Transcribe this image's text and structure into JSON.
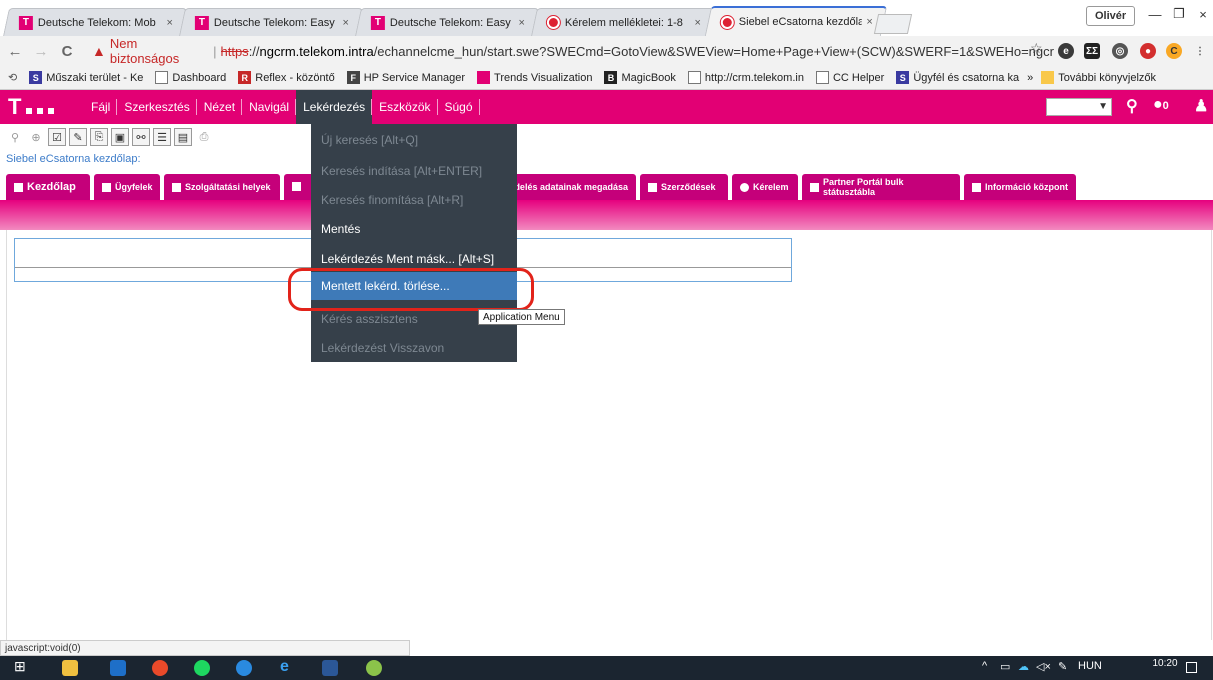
{
  "browser": {
    "tabs": [
      {
        "title": "Deutsche Telekom: Mob",
        "favicon": "telekom-t-icon",
        "active": false
      },
      {
        "title": "Deutsche Telekom: Easy",
        "favicon": "telekom-t-icon",
        "active": false
      },
      {
        "title": "Deutsche Telekom: Easy",
        "favicon": "telekom-t-icon",
        "active": false
      },
      {
        "title": "Kérelem mellékletei: 1-8",
        "favicon": "oracle-icon",
        "active": false
      },
      {
        "title": "Siebel eCsatorna kezdőla",
        "favicon": "oracle-icon",
        "active": true
      }
    ],
    "close_glyph": "×",
    "profile_name": "Olivér",
    "window_controls": [
      "—",
      "❐",
      "×"
    ],
    "nav": {
      "back": "←",
      "forward": "→",
      "reload": "C"
    },
    "address": {
      "security_label": "Nem biztonságos",
      "protocol": "https",
      "host": "ngcrm.telekom.intra",
      "path": "/echannelcme_hun/start.swe?SWECmd=GotoView&SWEView=Home+Page+View+(SCW)&SWERF=1&SWEHo=ngcr..."
    },
    "bookmarks": [
      {
        "label": "Műszaki terület - Ke",
        "icon": "siebel-icon",
        "color": "#3a3aa0"
      },
      {
        "label": "Dashboard",
        "icon": "page-icon",
        "color": "#ffffff"
      },
      {
        "label": "Reflex - közöntő",
        "icon": "reflex-icon",
        "color": "#c62828"
      },
      {
        "label": "HP Service Manager",
        "icon": "hp-icon",
        "color": "#444444"
      },
      {
        "label": "Trends Visualization",
        "icon": "trends-icon",
        "color": "#e20074"
      },
      {
        "label": "MagicBook",
        "icon": "magicbook-icon",
        "color": "#222222"
      },
      {
        "label": "http://crm.telekom.in",
        "icon": "page-icon",
        "color": "#ffffff"
      },
      {
        "label": "CC Helper",
        "icon": "page-icon",
        "color": "#ffffff"
      },
      {
        "label": "Ügyfél és csatorna ka",
        "icon": "siebel-icon",
        "color": "#3a3aa0"
      }
    ],
    "more_bookmarks_glyph": "»",
    "other_bookmarks": "További könyvjelzők"
  },
  "app": {
    "menu": [
      "Fájl",
      "Szerkesztés",
      "Nézet",
      "Navigál",
      "Lekérdezés",
      "Eszközök",
      "Súgó"
    ],
    "active_menu": "Lekérdezés",
    "breadcrumb": "Siebel eCsatorna kezdőlap:",
    "screen_tabs": [
      {
        "label": "Kezdőlap"
      },
      {
        "label": "Ügyfelek"
      },
      {
        "label": "Szolgáltatási helyek"
      },
      {
        "label": "delés adatainak megadása"
      },
      {
        "label": "Szerződések"
      },
      {
        "label": "Kérelem"
      },
      {
        "label": "Partner Portál bulk státusztábla"
      },
      {
        "label": "Információ központ"
      }
    ],
    "query_menu": [
      {
        "label": "Új keresés [Alt+Q]",
        "enabled": false
      },
      {
        "label": "Keresés indítása [Alt+ENTER]",
        "enabled": false
      },
      {
        "label": "Keresés finomítása [Alt+R]",
        "enabled": false
      },
      {
        "label": "Mentés",
        "enabled": true
      },
      {
        "label": "Lekérdezés Ment másk... [Alt+S]",
        "enabled": true
      },
      {
        "label": "Mentett lekérd. törlése...",
        "enabled": true,
        "highlighted": true
      },
      {
        "label": "Kérés asszisztens",
        "enabled": false
      },
      {
        "label": "Lekérdezést Visszavon",
        "enabled": false
      }
    ],
    "tooltip": "Application Menu",
    "notification_count": "0"
  },
  "status_bar": "javascript:void(0)",
  "taskbar": {
    "language": "HUN",
    "time": "10:20"
  },
  "colors": {
    "brand": "#e20074",
    "menu_dark": "#36404a",
    "highlight": "#3e7ab8",
    "annotation": "#e2231a"
  }
}
